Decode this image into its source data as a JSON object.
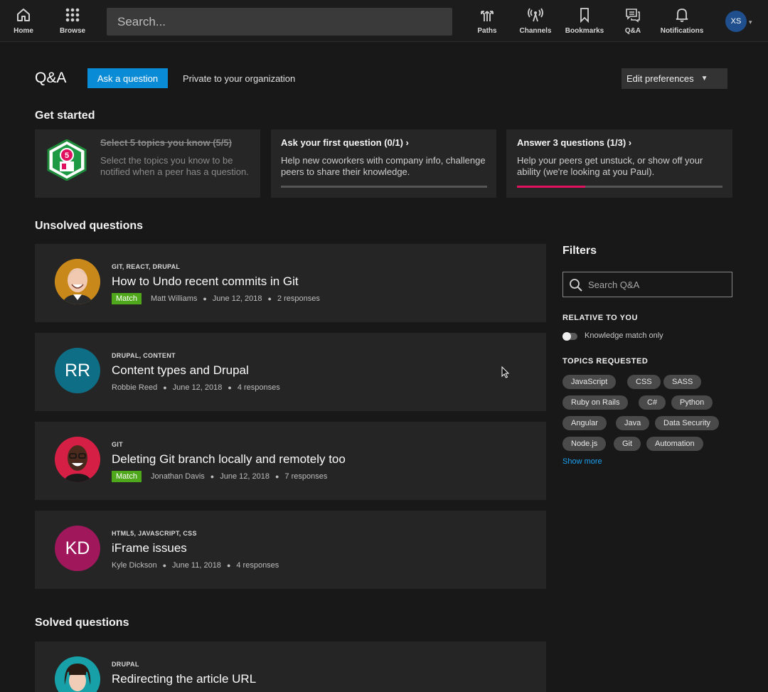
{
  "nav": {
    "home": "Home",
    "browse": "Browse",
    "search_placeholder": "Search...",
    "paths": "Paths",
    "channels": "Channels",
    "bookmarks": "Bookmarks",
    "qa": "Q&A",
    "notifications": "Notifications",
    "user_initials": "XS"
  },
  "header": {
    "title": "Q&A",
    "ask_button": "Ask a question",
    "private_text": "Private to your organization",
    "edit_preferences": "Edit preferences"
  },
  "get_started": {
    "title": "Get started",
    "cards": [
      {
        "title": "Select 5 topics you know (5/5)",
        "desc": "Select the topics you know to be notified when a peer has a question.",
        "completed": true,
        "badge_number": "5"
      },
      {
        "title": "Ask your first question (0/1)",
        "arrow": "›",
        "desc": "Help new coworkers with company info, challenge peers to share their knowledge.",
        "progress": 0.0
      },
      {
        "title": "Answer 3 questions (1/3)",
        "arrow": "›",
        "desc": "Help your peers get unstuck, or show off your ability (we're looking at you Paul).",
        "progress": 0.333
      }
    ]
  },
  "unsolved": {
    "title": "Unsolved questions",
    "questions": [
      {
        "tags": "GIT, REACT, DRUPAL",
        "title": "How to Undo recent commits in Git",
        "match": "Match",
        "author": "Matt Williams",
        "date": "June 12, 2018",
        "responses": "2 responses",
        "avatar": "photo",
        "color": "#c9891a"
      },
      {
        "tags": "DRUPAL, CONTENT",
        "title": "Content types and Drupal",
        "author": "Robbie Reed",
        "date": "June 12, 2018",
        "responses": "4 responses",
        "initials": "RR",
        "color": "#0e6e85"
      },
      {
        "tags": "GIT",
        "title": "Deleting Git branch locally and remotely too",
        "match": "Match",
        "author": "Jonathan Davis",
        "date": "June 12, 2018",
        "responses": "7 responses",
        "avatar": "photo",
        "color": "#d51f45"
      },
      {
        "tags": "HTML5, JAVASCRIPT, CSS",
        "title": "iFrame issues",
        "author": "Kyle Dickson",
        "date": "June 11, 2018",
        "responses": "4 responses",
        "initials": "KD",
        "color": "#a0175c"
      }
    ]
  },
  "solved": {
    "title": "Solved questions",
    "questions": [
      {
        "tags": "DRUPAL",
        "title": "Redirecting the article URL",
        "avatar": "photo",
        "color": "#17a0a8"
      }
    ]
  },
  "filters": {
    "title": "Filters",
    "search_placeholder": "Search Q&A",
    "relative_heading": "RELATIVE TO YOU",
    "knowledge_toggle": "Knowledge match only",
    "topics_heading": "TOPICS REQUESTED",
    "topics": [
      "JavaScript",
      "CSS",
      "SASS",
      "Ruby on Rails",
      "C#",
      "Python",
      "Angular",
      "Java",
      "Data Security",
      "Node.js",
      "Git",
      "Automation"
    ],
    "show_more": "Show more"
  },
  "colors": {
    "accent": "#0a8bd6",
    "match": "#4fa81b",
    "progress": "#e0115f",
    "link": "#1ba1f2"
  }
}
